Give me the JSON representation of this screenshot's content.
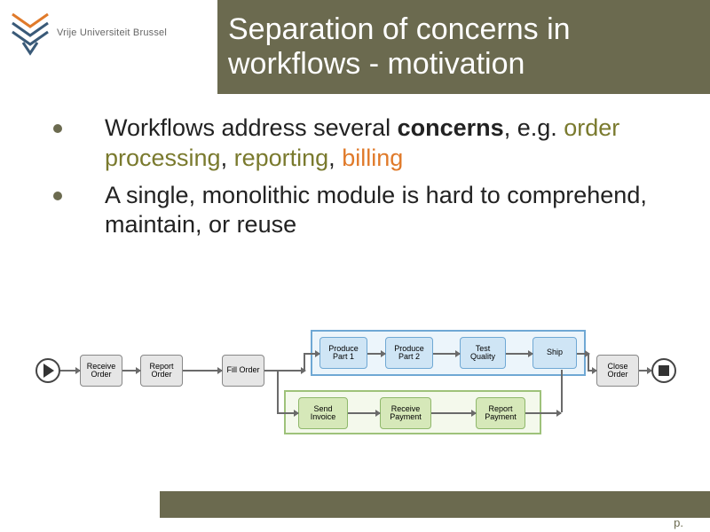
{
  "header": {
    "university": "Vrije Universiteit Brussel",
    "title_line1": "Separation of concerns in",
    "title_line2": "workflows - motivation"
  },
  "bullets": [
    {
      "pre": "Workflows address several ",
      "bold": "concerns",
      "post": ", e.g. ",
      "c1": "order processing",
      "sep1": ", ",
      "c2": "reporting",
      "sep2": ", ",
      "c3": "billing"
    },
    {
      "text": "A single, monolithic module is hard to comprehend, maintain, or reuse"
    }
  ],
  "diagram": {
    "nodes": {
      "receive_order": "Receive Order",
      "report_order": "Report Order",
      "fill_order": "Fill Order",
      "produce_part1": "Produce Part 1",
      "produce_part2": "Produce Part 2",
      "test_quality": "Test Quality",
      "ship": "Ship",
      "send_invoice": "Send Invoice",
      "receive_payment": "Receive Payment",
      "report_payment": "Report Payment",
      "close_order": "Close Order"
    }
  },
  "footer": {
    "page_label": "p."
  }
}
